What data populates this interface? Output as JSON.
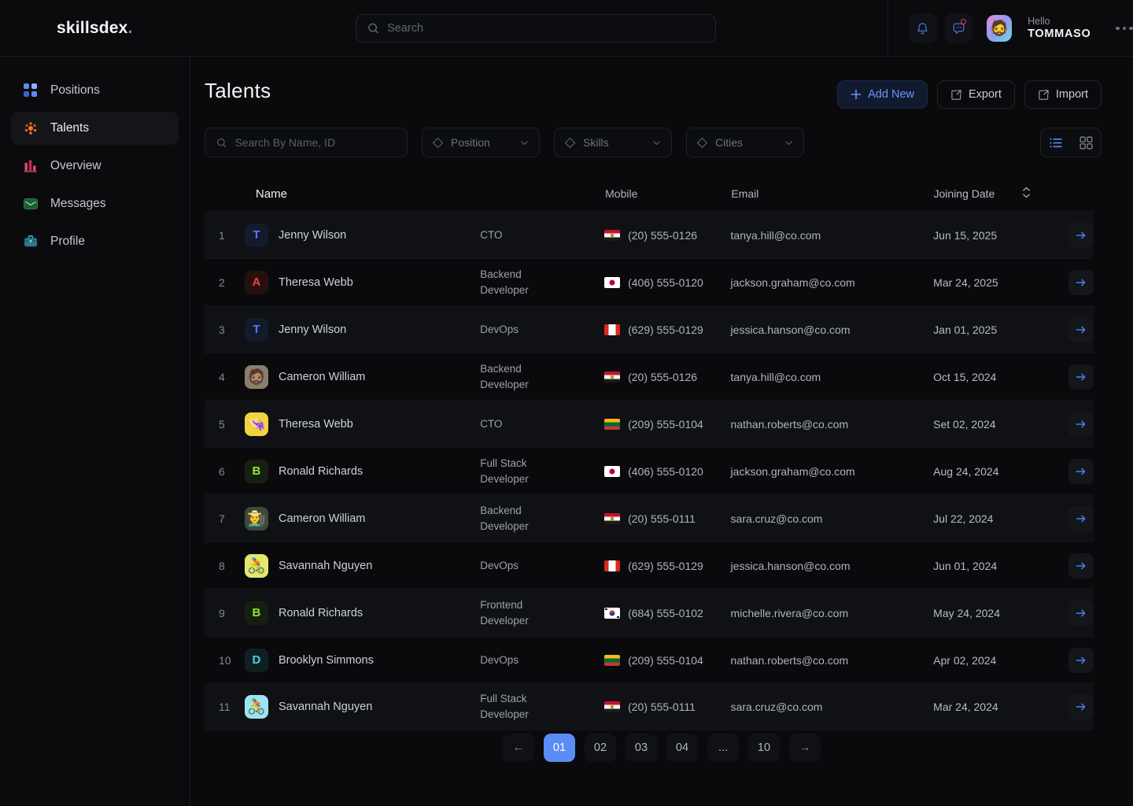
{
  "brand": {
    "name": "skillsdex",
    "dot": "."
  },
  "topbar": {
    "search_placeholder": "Search",
    "search_value": "",
    "notifications_icon": "bell-icon",
    "messages_icon": "chat-bubble-icon",
    "greeting": "Hello",
    "username": "TOMMASO",
    "more_icon": "more-horizontal-icon"
  },
  "sidebar": {
    "items": [
      {
        "label": "Positions",
        "icon": "grid-squares-icon",
        "active": false
      },
      {
        "label": "Talents",
        "icon": "people-dots-icon",
        "active": true
      },
      {
        "label": "Overview",
        "icon": "bar-chart-icon",
        "active": false
      },
      {
        "label": "Messages",
        "icon": "envelope-icon",
        "active": false
      },
      {
        "label": "Profile",
        "icon": "briefcase-icon",
        "active": false
      }
    ]
  },
  "page": {
    "title": "Talents"
  },
  "toolbar": {
    "add_new": "Add New",
    "export": "Export",
    "import": "Import",
    "view_list": "list-view-icon",
    "view_grid": "grid-view-icon",
    "active_view": "list"
  },
  "filters": {
    "search_placeholder": "Search By Name, ID",
    "search_value": "",
    "selects": [
      {
        "label": "Position",
        "icon": "diamond-icon"
      },
      {
        "label": "Skills",
        "icon": "diamond-icon"
      },
      {
        "label": "Cities",
        "icon": "diamond-icon"
      }
    ]
  },
  "table": {
    "columns": [
      "",
      "Name",
      "",
      "Mobile",
      "Email",
      "Joining Date",
      ""
    ],
    "headers": {
      "name": "Name",
      "mobile": "Mobile",
      "email": "Email",
      "joining_date": "Joining Date"
    },
    "sort_icon": "sort-updown-icon",
    "rows": [
      {
        "index": "1",
        "avatar_type": "letter",
        "avatar": "T",
        "avatar_color": "#4d7ef0",
        "avatar_bg": "#131a2b",
        "name": "Jenny Wilson",
        "role": "CTO",
        "flag": "eg",
        "mobile": "(20) 555-0126",
        "email": "tanya.hill@co.com",
        "date": "Jun 15, 2025"
      },
      {
        "index": "2",
        "avatar_type": "letter",
        "avatar": "A",
        "avatar_color": "#e8453c",
        "avatar_bg": "#26100f",
        "name": "Theresa Webb",
        "role": "Backend Developer",
        "flag": "jp",
        "mobile": "(406) 555-0120",
        "email": "jackson.graham@co.com",
        "date": "Mar 24, 2025"
      },
      {
        "index": "3",
        "avatar_type": "letter",
        "avatar": "T",
        "avatar_color": "#4d7ef0",
        "avatar_bg": "#131a2b",
        "name": "Jenny Wilson",
        "role": "DevOps",
        "flag": "ca",
        "mobile": "(629) 555-0129",
        "email": "jessica.hanson@co.com",
        "date": "Jan 01, 2025"
      },
      {
        "index": "4",
        "avatar_type": "emoji",
        "avatar": "🧔🏽",
        "avatar_color": "",
        "avatar_bg": "#8a7f6d",
        "name": "Cameron William",
        "role": "Backend Developer",
        "flag": "eg",
        "mobile": "(20) 555-0126",
        "email": "tanya.hill@co.com",
        "date": "Oct 15, 2024"
      },
      {
        "index": "5",
        "avatar_type": "emoji",
        "avatar": "👒",
        "avatar_color": "",
        "avatar_bg": "#f2d33d",
        "name": "Theresa Webb",
        "role": "CTO",
        "flag": "lt",
        "mobile": "(209) 555-0104",
        "email": "nathan.roberts@co.com",
        "date": "Set 02, 2024"
      },
      {
        "index": "6",
        "avatar_type": "letter",
        "avatar": "B",
        "avatar_color": "#8ee63f",
        "avatar_bg": "#16200f",
        "name": "Ronald Richards",
        "role": "Full Stack Developer",
        "flag": "jp",
        "mobile": "(406) 555-0120",
        "email": "jackson.graham@co.com",
        "date": "Aug 24, 2024"
      },
      {
        "index": "7",
        "avatar_type": "emoji",
        "avatar": "🧑‍🌾",
        "avatar_color": "",
        "avatar_bg": "#3d4a3a",
        "name": "Cameron William",
        "role": "Backend Developer",
        "flag": "eg",
        "mobile": "(20) 555-0111",
        "email": "sara.cruz@co.com",
        "date": "Jul 22, 2024"
      },
      {
        "index": "8",
        "avatar_type": "emoji",
        "avatar": "🚴",
        "avatar_color": "",
        "avatar_bg": "#e2e86a",
        "name": "Savannah Nguyen",
        "role": "DevOps",
        "flag": "ca",
        "mobile": "(629) 555-0129",
        "email": "jessica.hanson@co.com",
        "date": "Jun 01, 2024"
      },
      {
        "index": "9",
        "avatar_type": "letter",
        "avatar": "B",
        "avatar_color": "#8ee63f",
        "avatar_bg": "#16200f",
        "name": "Ronald Richards",
        "role": "Frontend Developer",
        "flag": "kr",
        "mobile": "(684) 555-0102",
        "email": "michelle.rivera@co.com",
        "date": "May 24, 2024"
      },
      {
        "index": "10",
        "avatar_type": "letter",
        "avatar": "D",
        "avatar_color": "#4fd0e0",
        "avatar_bg": "#0f2024",
        "name": "Brooklyn Simmons",
        "role": "DevOps",
        "flag": "lt",
        "mobile": "(209) 555-0104",
        "email": "nathan.roberts@co.com",
        "date": "Apr 02, 2024"
      },
      {
        "index": "11",
        "avatar_type": "emoji",
        "avatar": "🚴",
        "avatar_color": "",
        "avatar_bg": "#9fe3f0",
        "name": "Savannah Nguyen",
        "role": "Full Stack Developer",
        "flag": "eg",
        "mobile": "(20) 555-0111",
        "email": "sara.cruz@co.com",
        "date": "Mar 24, 2024"
      }
    ],
    "row_action_icon": "arrow-right-icon"
  },
  "pagination": {
    "prev": "←",
    "next": "→",
    "pages": [
      "01",
      "02",
      "03",
      "04",
      "...",
      "10"
    ],
    "active": "01"
  },
  "colors": {
    "accent_blue": "#5b8cf5",
    "page_bg": "#0a0a0c",
    "panel_bg": "#0b0b0d",
    "row_alt_bg": "#101114",
    "badge_red": "#e2483c"
  }
}
